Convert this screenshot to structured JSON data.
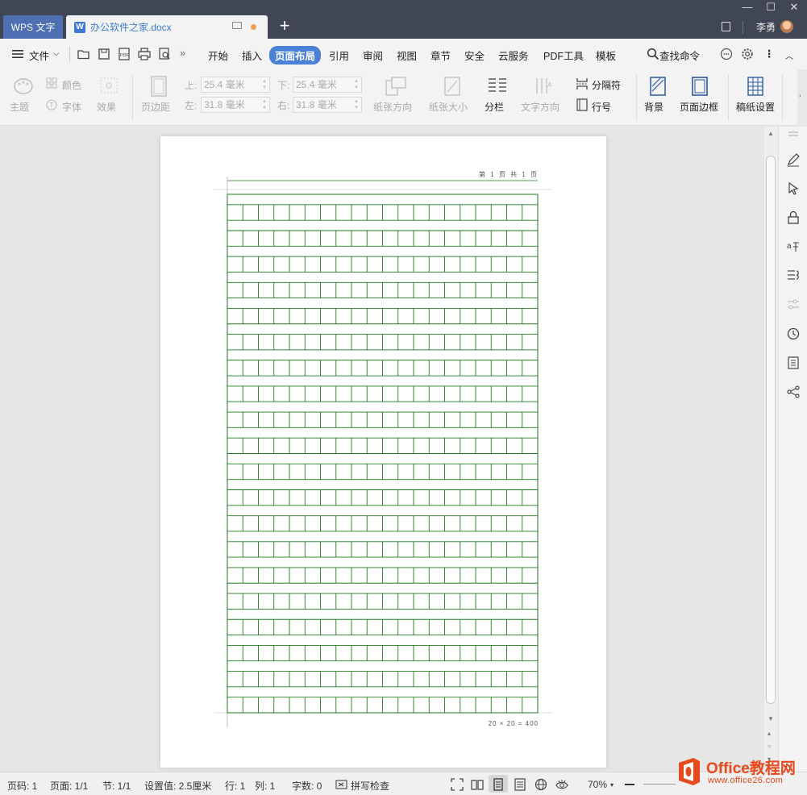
{
  "titlebar": {
    "app_tab": "WPS 文字",
    "doc_tab": "办公软件之家.docx",
    "new_tab": "+",
    "user": "李勇",
    "min": "—",
    "max": "☐",
    "close": "✕"
  },
  "menubar": {
    "file": "文件",
    "tabs": [
      "开始",
      "插入",
      "页面布局",
      "引用",
      "审阅",
      "视图",
      "章节",
      "安全",
      "云服务",
      "PDF工具",
      "模板"
    ],
    "active_tab": "页面布局",
    "search": "查找命令",
    "more": "»"
  },
  "ribbon": {
    "theme": "主题",
    "color": "颜色",
    "font": "字体",
    "effect": "效果",
    "margin": "页边距",
    "top_label": "上:",
    "top_value": "25.4 毫米",
    "bottom_label": "下:",
    "bottom_value": "25.4 毫米",
    "left_label": "左:",
    "left_value": "31.8 毫米",
    "right_label": "右:",
    "right_value": "31.8 毫米",
    "orientation": "纸张方向",
    "size": "纸张大小",
    "columns": "分栏",
    "text_direction": "文字方向",
    "separator": "分隔符",
    "line_number": "行号",
    "background": "背景",
    "page_border": "页面边框",
    "grid_paper": "稿纸设置"
  },
  "page": {
    "header": "第 1 页 共 1 页",
    "footer": "20 × 20 = 400",
    "grid_rows": 20,
    "grid_cols": 20,
    "grid_color": "#1e7a1e"
  },
  "statusbar": {
    "page_no": "页码: 1",
    "pages": "页面: 1/1",
    "section": "节: 1/1",
    "setting": "设置值: 2.5厘米",
    "row": "行: 1",
    "col": "列: 1",
    "words": "字数: 0",
    "spell": "拼写检查",
    "zoom": "70%"
  },
  "watermark": {
    "title": "Office教程网",
    "url": "www.office26.com"
  },
  "colors": {
    "accent": "#4a80d6",
    "titlebar": "#404654",
    "grid": "#1e7a1e",
    "watermark": "#e8491d"
  }
}
